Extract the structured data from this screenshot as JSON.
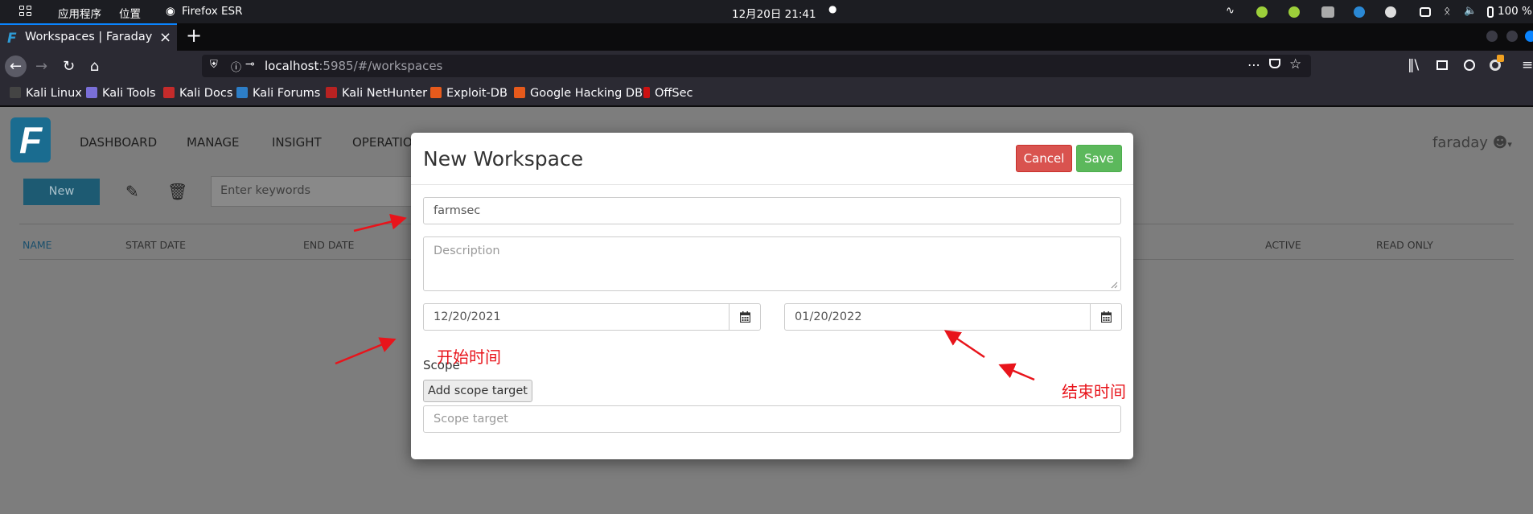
{
  "os_bar": {
    "apps_menu": "应用程序",
    "places_menu": "位置",
    "active_app": "Firefox ESR",
    "clock": "12月20日  21:41",
    "battery": "100 %"
  },
  "browser": {
    "tab": {
      "title": "Workspaces | Faraday"
    },
    "url": {
      "host": "localhost",
      "rest": ":5985/#/workspaces"
    },
    "bookmarks": [
      "Kali Linux",
      "Kali Tools",
      "Kali Docs",
      "Kali Forums",
      "Kali NetHunter",
      "Exploit-DB",
      "Google Hacking DB",
      "OffSec"
    ]
  },
  "app": {
    "nav": [
      "DASHBOARD",
      "MANAGE",
      "INSIGHT",
      "OPERATIO"
    ],
    "user": "faraday",
    "toolbar": {
      "new_label": "New",
      "search_placeholder": "Enter keywords"
    },
    "table_headers": {
      "name": "NAME",
      "start_date": "START DATE",
      "end_date": "END DATE",
      "active": "ACTIVE",
      "read_only": "READ ONLY"
    }
  },
  "modal": {
    "title": "New Workspace",
    "cancel_label": "Cancel",
    "save_label": "Save",
    "name_value": "farmsec",
    "description_placeholder": "Description",
    "start_date": "12/20/2021",
    "end_date": "01/20/2022",
    "scope_label": "Scope",
    "add_scope_label": "Add scope target",
    "scope_placeholder": "Scope target"
  },
  "annotations": {
    "start_note": "开始时间",
    "end_note": "结束时间"
  },
  "colors": {
    "cancel": "#d9534f",
    "save": "#5cb85c",
    "annotation": "#e8141b",
    "firefox_accent": "#0a84ff"
  }
}
